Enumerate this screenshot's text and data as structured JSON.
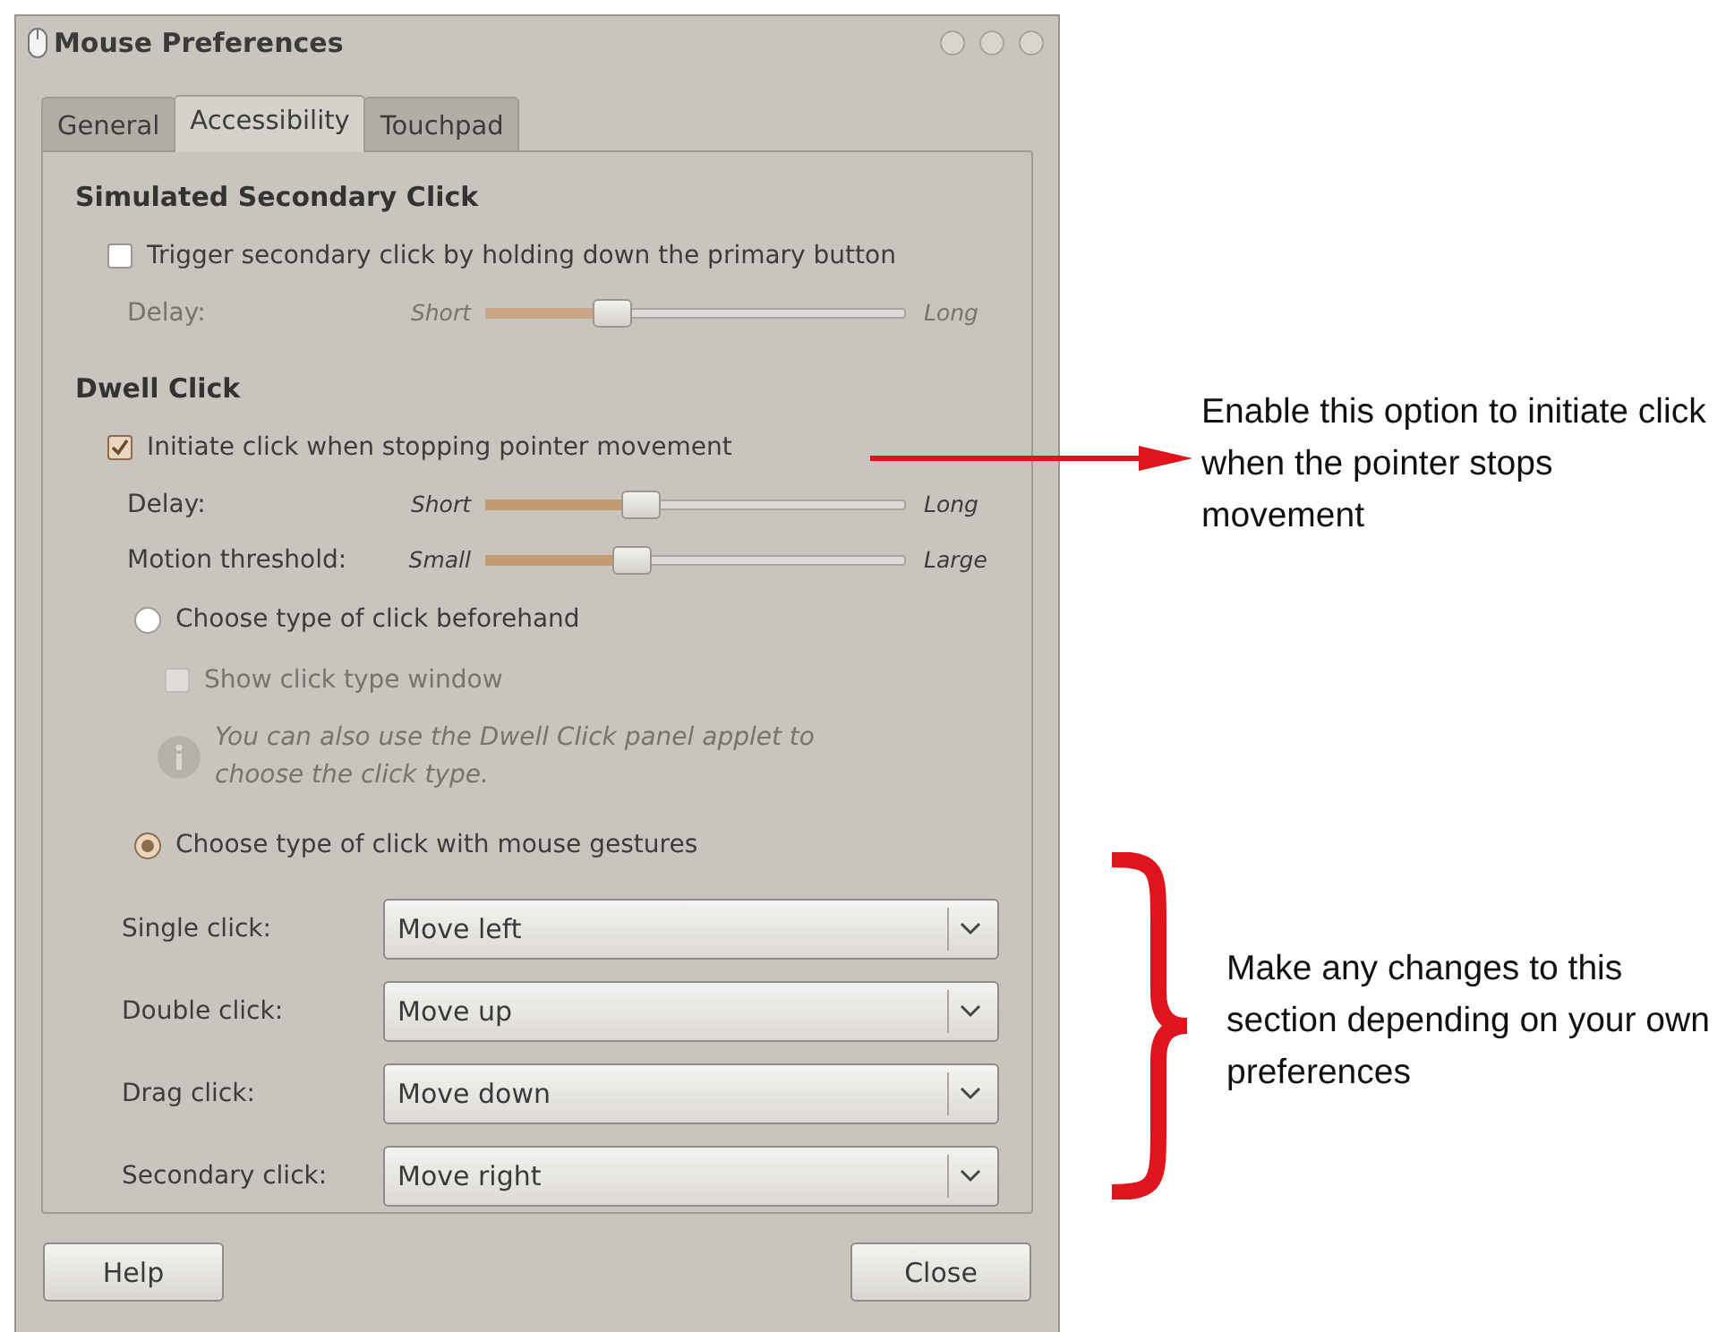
{
  "window": {
    "title": "Mouse Preferences"
  },
  "tabs": [
    {
      "label": "General",
      "selected": false
    },
    {
      "label": "Accessibility",
      "selected": true
    },
    {
      "label": "Touchpad",
      "selected": false
    }
  ],
  "secondary_click": {
    "title": "Simulated Secondary Click",
    "checkbox": {
      "label": "Trigger secondary click by holding down the primary button",
      "checked": false
    },
    "slider": {
      "label": "Delay:",
      "min_label": "Short",
      "max_label": "Long",
      "level": 0.3,
      "disabled": true
    }
  },
  "dwell_click": {
    "title": "Dwell Click",
    "checkbox": {
      "label": "Initiate click when stopping pointer movement",
      "checked": true
    },
    "sliders": [
      {
        "label": "Delay:",
        "min_label": "Short",
        "max_label": "Long",
        "level": 0.37,
        "disabled": false
      },
      {
        "label": "Motion threshold:",
        "min_label": "Small",
        "max_label": "Large",
        "level": 0.35,
        "disabled": false
      }
    ],
    "modes": [
      {
        "label": "Choose type of click beforehand",
        "selected": false,
        "option": {
          "label": "Show click type window",
          "checked": false,
          "disabled": true
        },
        "note": {
          "text": "You can also use the Dwell Click panel applet to choose the click type.",
          "disabled": true
        }
      },
      {
        "label": "Choose type of click with mouse gestures",
        "selected": true,
        "gestures": [
          {
            "label": "Single click:",
            "value": "Move left"
          },
          {
            "label": "Double click:",
            "value": "Move up"
          },
          {
            "label": "Drag click:",
            "value": "Move down"
          },
          {
            "label": "Secondary click:",
            "value": "Move right"
          }
        ]
      }
    ]
  },
  "buttons": [
    {
      "label": "Help"
    },
    {
      "label": "Close"
    }
  ],
  "annotations": [
    {
      "kind": "arrow",
      "text": "Enable this option to initiate click when the pointer stops movement"
    },
    {
      "kind": "brace",
      "text": "Make any changes to this section depending on your own preferences"
    }
  ]
}
